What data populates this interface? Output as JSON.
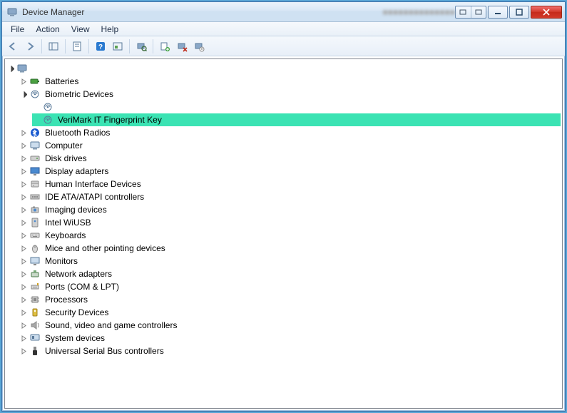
{
  "window": {
    "title": "Device Manager"
  },
  "menubar": {
    "items": [
      "File",
      "Action",
      "View",
      "Help"
    ]
  },
  "toolbar": {
    "labels": {
      "back": "Back",
      "forward": "Forward",
      "showhide": "Show/Hide Console Tree",
      "properties": "Properties",
      "help": "Help",
      "refresh": "Refresh",
      "scan": "Scan for hardware changes",
      "update": "Update Driver Software",
      "uninstall": "Uninstall",
      "disable": "Disable"
    }
  },
  "tree": {
    "root": {
      "label": "(Computer)",
      "blurred": true
    },
    "items": [
      {
        "label": "Batteries",
        "icon": "battery",
        "expandable": true
      },
      {
        "label": "Biometric Devices",
        "icon": "biometric",
        "expandable": true,
        "expanded": true,
        "children": [
          {
            "label": "(hidden)",
            "icon": "biometric",
            "blurred": true
          },
          {
            "label": "VeriMark IT Fingerprint Key",
            "icon": "biometric",
            "selected": true
          }
        ]
      },
      {
        "label": "Bluetooth Radios",
        "icon": "bluetooth",
        "expandable": true
      },
      {
        "label": "Computer",
        "icon": "computer",
        "expandable": true
      },
      {
        "label": "Disk drives",
        "icon": "disk",
        "expandable": true
      },
      {
        "label": "Display adapters",
        "icon": "display",
        "expandable": true
      },
      {
        "label": "Human Interface Devices",
        "icon": "hid",
        "expandable": true
      },
      {
        "label": "IDE ATA/ATAPI controllers",
        "icon": "ide",
        "expandable": true
      },
      {
        "label": "Imaging devices",
        "icon": "imaging",
        "expandable": true
      },
      {
        "label": "Intel WiUSB",
        "icon": "usbctrl",
        "expandable": true
      },
      {
        "label": "Keyboards",
        "icon": "keyboard",
        "expandable": true
      },
      {
        "label": "Mice and other pointing devices",
        "icon": "mouse",
        "expandable": true
      },
      {
        "label": "Monitors",
        "icon": "monitor",
        "expandable": true
      },
      {
        "label": "Network adapters",
        "icon": "network",
        "expandable": true
      },
      {
        "label": "Ports (COM & LPT)",
        "icon": "port",
        "expandable": true
      },
      {
        "label": "Processors",
        "icon": "processor",
        "expandable": true
      },
      {
        "label": "Security Devices",
        "icon": "security",
        "expandable": true
      },
      {
        "label": "Sound, video and game controllers",
        "icon": "sound",
        "expandable": true
      },
      {
        "label": "System devices",
        "icon": "system",
        "expandable": true
      },
      {
        "label": "Universal Serial Bus controllers",
        "icon": "usb",
        "expandable": true
      }
    ]
  }
}
